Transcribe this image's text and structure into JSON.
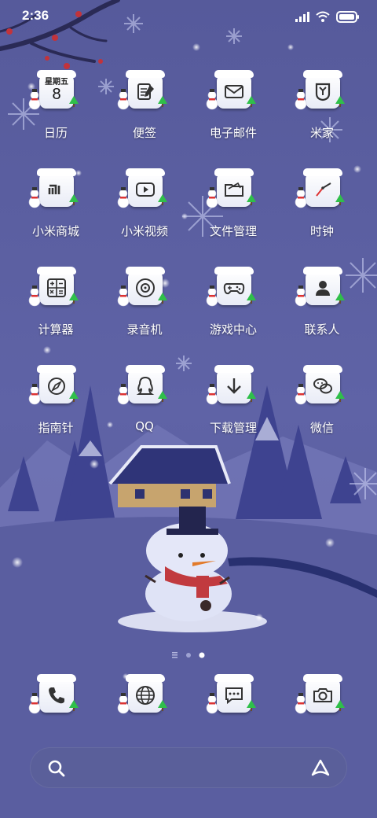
{
  "status_bar": {
    "time": "2:36",
    "battery_icon": "battery-icon",
    "wifi_icon": "wifi-icon",
    "signal_icon": "signal-icon"
  },
  "calendar": {
    "weekday": "星期五",
    "date": "8"
  },
  "apps": [
    {
      "label": "日历",
      "icon": "calendar-icon"
    },
    {
      "label": "便签",
      "icon": "notes-icon"
    },
    {
      "label": "电子邮件",
      "icon": "email-icon"
    },
    {
      "label": "米家",
      "icon": "mijia-icon"
    },
    {
      "label": "小米商城",
      "icon": "mi-store-icon"
    },
    {
      "label": "小米视频",
      "icon": "video-icon"
    },
    {
      "label": "文件管理",
      "icon": "folder-icon"
    },
    {
      "label": "时钟",
      "icon": "clock-icon"
    },
    {
      "label": "计算器",
      "icon": "calculator-icon"
    },
    {
      "label": "录音机",
      "icon": "recorder-icon"
    },
    {
      "label": "游戏中心",
      "icon": "gamepad-icon"
    },
    {
      "label": "联系人",
      "icon": "contacts-icon"
    },
    {
      "label": "指南针",
      "icon": "compass-icon"
    },
    {
      "label": "QQ",
      "icon": "qq-icon"
    },
    {
      "label": "下载管理",
      "icon": "download-icon"
    },
    {
      "label": "微信",
      "icon": "wechat-icon"
    }
  ],
  "dock": [
    {
      "icon": "phone-icon"
    },
    {
      "icon": "browser-icon"
    },
    {
      "icon": "messages-icon"
    },
    {
      "icon": "camera-icon"
    }
  ],
  "pager": {
    "pages": 3,
    "current": 3
  },
  "search": {
    "search_icon": "search-icon",
    "assistant_icon": "assistant-icon"
  },
  "colors": {
    "background": "#5b5e9f",
    "label": "#ffffff",
    "accent_green": "#2fbf4a"
  }
}
